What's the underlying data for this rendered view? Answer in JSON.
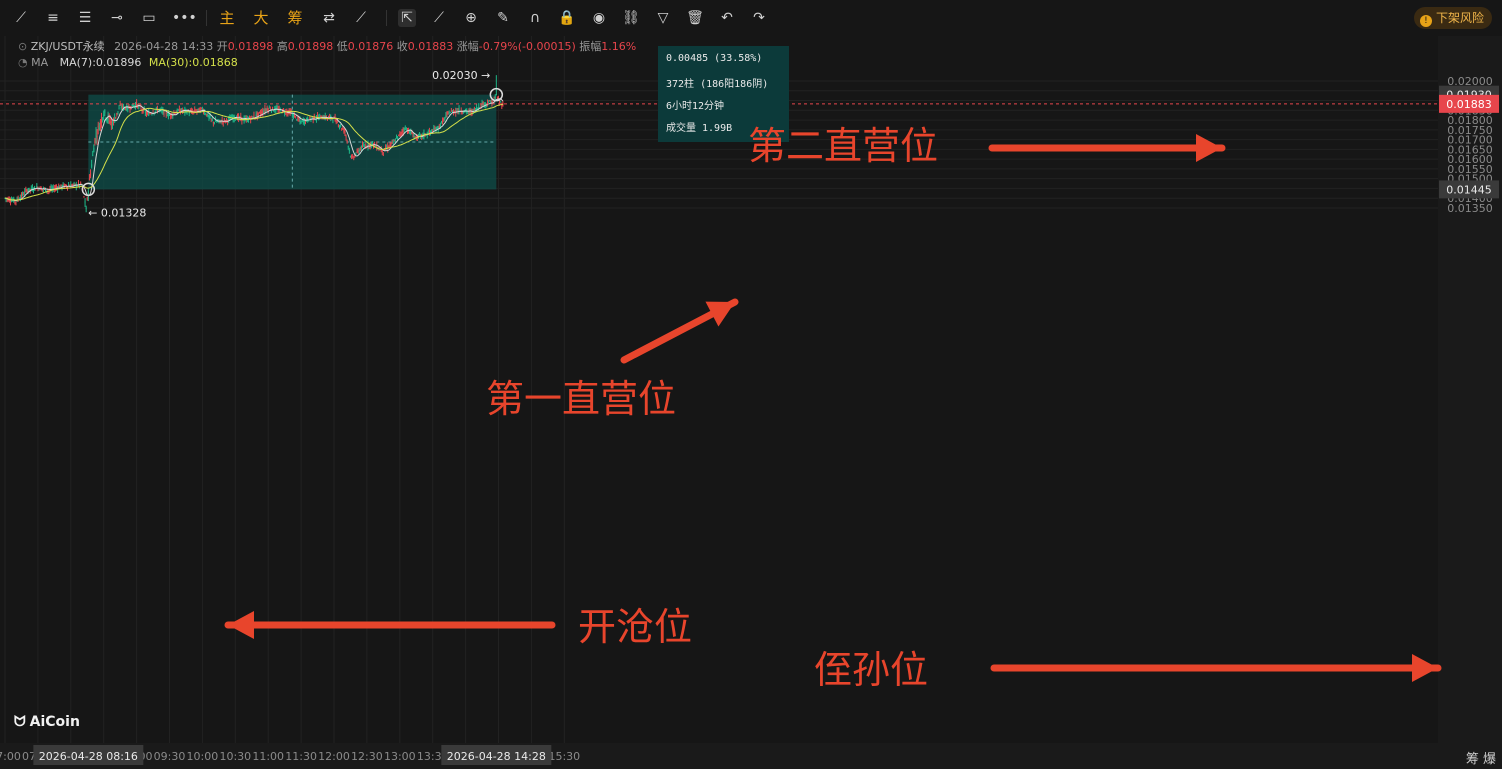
{
  "toolbar": {
    "tools": [
      {
        "name": "trend-line-icon",
        "glyph": "⟋"
      },
      {
        "name": "parallel-lines-icon",
        "glyph": "≡"
      },
      {
        "name": "horizontal-lines-icon",
        "glyph": "☰"
      },
      {
        "name": "horizontal-ray-icon",
        "glyph": "⊸"
      },
      {
        "name": "rectangle-icon",
        "glyph": "▭"
      },
      {
        "name": "more-shapes-icon",
        "glyph": "•••"
      },
      {
        "name": "sep"
      },
      {
        "name": "main-indicator-button",
        "glyph": "主",
        "cn": true
      },
      {
        "name": "large-order-button",
        "glyph": "大",
        "cn": true
      },
      {
        "name": "chip-distribution-button",
        "glyph": "筹",
        "cn": true
      },
      {
        "name": "compare-icon",
        "glyph": "⇄"
      },
      {
        "name": "magic-icon",
        "glyph": "⟋"
      },
      {
        "name": "sep"
      },
      {
        "name": "cursor-select-icon",
        "glyph": "⇱",
        "sel": true
      },
      {
        "name": "ruler-icon",
        "glyph": "⟋"
      },
      {
        "name": "zoom-icon",
        "glyph": "⊕"
      },
      {
        "name": "brush-icon",
        "glyph": "✎"
      },
      {
        "name": "magnet-icon",
        "glyph": "∩"
      },
      {
        "name": "lock-icon",
        "glyph": "🔒"
      },
      {
        "name": "eye-icon",
        "glyph": "◉"
      },
      {
        "name": "link-icon",
        "glyph": "⛓"
      },
      {
        "name": "filter-icon",
        "glyph": "▽"
      },
      {
        "name": "trash-icon",
        "glyph": "🗑"
      },
      {
        "name": "undo-icon",
        "glyph": "↶"
      },
      {
        "name": "redo-icon",
        "glyph": "↷"
      }
    ],
    "risk_label": "下架风险"
  },
  "info": {
    "symbol": "ZKJ/USDT永续",
    "datetime": "2026-04-28 14:33",
    "open_label": "开",
    "open": "0.01898",
    "high_label": "高",
    "high": "0.01898",
    "low_label": "低",
    "low": "0.01876",
    "close_label": "收",
    "close": "0.01883",
    "change_label": "涨幅",
    "change": "-0.79%(-0.00015)",
    "amp_label": "振幅",
    "amp": "1.16%",
    "ma_label": "MA",
    "ma7": "MA(7):0.01896",
    "ma30": "MA(30):0.01868"
  },
  "measure": {
    "line1": "0.00485 (33.58%)",
    "line2": "372柱 (186阳186阴)",
    "line3": "6小时12分钟",
    "line4": "成交量 1.99B"
  },
  "annotations": {
    "second": "第二直营位",
    "first": "第一直营位",
    "entry": "开沧位",
    "stop": "侄孙位"
  },
  "price_labels": {
    "high_marker": "0.02030",
    "low_marker": "0.01328",
    "current": "0.01883",
    "box_top": "0.01930",
    "box_bottom": "0.01445"
  },
  "time_labels": {
    "cursor_left": "2026-04-28 08:16",
    "cursor_right": "2026-04-28 14:28"
  },
  "watermark": "AiCoin",
  "footer": "筹 爆",
  "colors": {
    "up": "#1fb889",
    "down": "#e7454c",
    "ma7": "#d8d8d8",
    "ma30": "#d4e04a",
    "box": "#0e4d4a",
    "arrow": "#e8452c",
    "bg": "#161616",
    "grid": "#222222"
  },
  "chart_data": {
    "type": "candlestick",
    "title": "ZKJ/USDT永续",
    "interval": "1m",
    "y_ticks": [
      "0.02000",
      "0.01950",
      "0.01900",
      "0.01850",
      "0.01800",
      "0.01750",
      "0.01700",
      "0.01650",
      "0.01600",
      "0.01550",
      "0.01500",
      "0.01450",
      "0.01400",
      "0.01350"
    ],
    "x_ticks": [
      "07:00",
      "07:30",
      "08:00",
      "08:30",
      "09:00",
      "09:30",
      "10:00",
      "10:30",
      "11:00",
      "11:30",
      "12:00",
      "12:30",
      "13:00",
      "13:30",
      "14:00",
      "14:30",
      "15:00",
      "15:30"
    ],
    "ylim": [
      0.0131,
      0.0208
    ],
    "xlim": [
      "06:59",
      "15:45"
    ],
    "grid": true,
    "series": [
      {
        "name": "MA(7)",
        "values": "close moving average, 7 periods"
      },
      {
        "name": "MA(30)",
        "values": "close moving average, 30 periods"
      }
    ],
    "price_path": [
      [
        "07:00",
        0.014
      ],
      [
        "07:10",
        0.01385
      ],
      [
        "07:20",
        0.0144
      ],
      [
        "07:30",
        0.01455
      ],
      [
        "07:40",
        0.0144
      ],
      [
        "07:50",
        0.0146
      ],
      [
        "08:00",
        0.01465
      ],
      [
        "08:10",
        0.0147
      ],
      [
        "08:14",
        0.01345
      ],
      [
        "08:16",
        0.01445
      ],
      [
        "08:22",
        0.017
      ],
      [
        "08:30",
        0.0184
      ],
      [
        "08:38",
        0.0178
      ],
      [
        "08:45",
        0.0187
      ],
      [
        "08:52",
        0.0186
      ],
      [
        "09:00",
        0.0188
      ],
      [
        "09:10",
        0.0183
      ],
      [
        "09:20",
        0.01855
      ],
      [
        "09:30",
        0.01825
      ],
      [
        "09:40",
        0.0185
      ],
      [
        "09:50",
        0.0184
      ],
      [
        "10:00",
        0.01855
      ],
      [
        "10:10",
        0.0179
      ],
      [
        "10:20",
        0.01795
      ],
      [
        "10:30",
        0.01815
      ],
      [
        "10:40",
        0.018
      ],
      [
        "10:50",
        0.01825
      ],
      [
        "11:00",
        0.0186
      ],
      [
        "11:10",
        0.0185
      ],
      [
        "11:20",
        0.0184
      ],
      [
        "11:30",
        0.0179
      ],
      [
        "11:40",
        0.0181
      ],
      [
        "11:50",
        0.01815
      ],
      [
        "12:00",
        0.0181
      ],
      [
        "12:10",
        0.0174
      ],
      [
        "12:16",
        0.016
      ],
      [
        "12:25",
        0.0166
      ],
      [
        "12:35",
        0.0168
      ],
      [
        "12:45",
        0.0164
      ],
      [
        "12:55",
        0.0169
      ],
      [
        "13:05",
        0.0176
      ],
      [
        "13:15",
        0.0171
      ],
      [
        "13:25",
        0.0173
      ],
      [
        "13:35",
        0.0176
      ],
      [
        "13:45",
        0.0184
      ],
      [
        "13:55",
        0.0185
      ],
      [
        "14:05",
        0.0184
      ],
      [
        "14:15",
        0.0188
      ],
      [
        "14:25",
        0.01895
      ],
      [
        "14:28",
        0.0193
      ],
      [
        "14:30",
        0.019
      ],
      [
        "14:33",
        0.01883
      ]
    ],
    "high": 0.0203,
    "low": 0.01328,
    "current": 0.01883,
    "measure_box": {
      "from_time": "08:16",
      "to_time": "14:28",
      "from_price": 0.01445,
      "to_price": 0.0193,
      "change": 0.00485,
      "change_pct": 33.58,
      "bars": 372,
      "up_bars": 186,
      "down_bars": 186,
      "duration": "6小时12分钟",
      "volume": "1.99B"
    },
    "levels": [
      {
        "label": "开沧位",
        "price": 0.01445
      },
      {
        "label": "第一直营位",
        "price": 0.0169
      },
      {
        "label": "第二直营位",
        "price": 0.0193
      },
      {
        "label": "侄孙位",
        "price": 0.014
      }
    ]
  }
}
